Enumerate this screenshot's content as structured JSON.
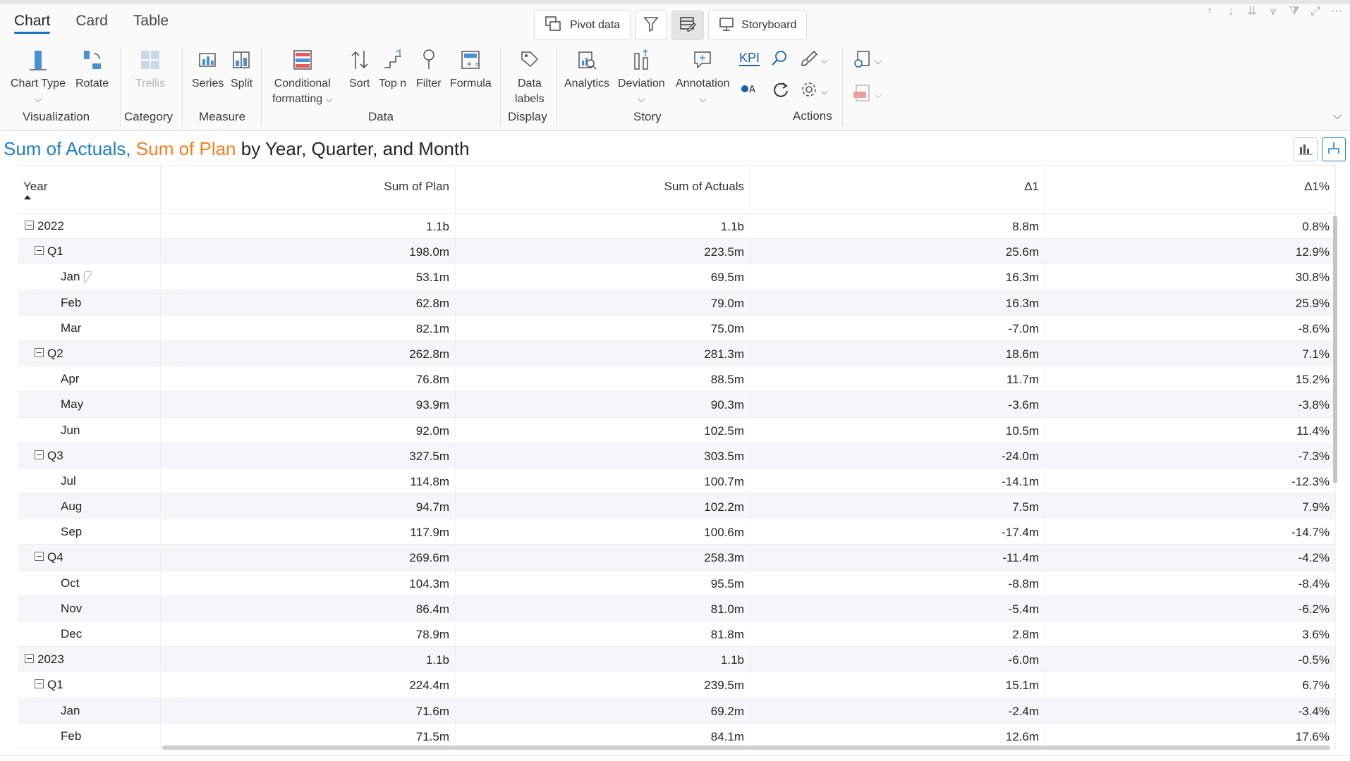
{
  "ribbon": {
    "tabs": [
      {
        "label": "Chart",
        "active": true
      },
      {
        "label": "Card",
        "active": false
      },
      {
        "label": "Table",
        "active": false
      }
    ],
    "pivot_label": "Pivot data",
    "storyboard_label": "Storyboard",
    "items": {
      "chart_type": "Chart Type",
      "rotate": "Rotate",
      "trellis": "Trellis",
      "series": "Series",
      "split": "Split",
      "conditional": "Conditional",
      "formatting": "formatting",
      "sort": "Sort",
      "topn": "Top n",
      "filter": "Filter",
      "formula": "Formula",
      "data": "Data",
      "labels": "labels",
      "analytics": "Analytics",
      "deviation": "Deviation",
      "annotation": "Annotation",
      "kpi": "KPI"
    },
    "groups": {
      "visualization": "Visualization",
      "category": "Category",
      "measure": "Measure",
      "data": "Data",
      "display": "Display",
      "story": "Story",
      "actions": "Actions"
    }
  },
  "title": {
    "actuals": "Sum of Actuals",
    "comma": ",",
    "plan": "Sum of Plan",
    "rest": "by Year, Quarter, and Month"
  },
  "table": {
    "headers": [
      "Year",
      "Sum of Plan",
      "Sum of Actuals",
      "Δ1",
      "Δ1%"
    ],
    "rows": [
      {
        "label": "2022",
        "level": 0,
        "plan": "1.1b",
        "actuals": "1.1b",
        "d1": "8.8m",
        "d1p": "0.8%"
      },
      {
        "label": "Q1",
        "level": 1,
        "plan": "198.0m",
        "actuals": "223.5m",
        "d1": "25.6m",
        "d1p": "12.9%"
      },
      {
        "label": "Jan",
        "level": 2,
        "plan": "53.1m",
        "actuals": "69.5m",
        "d1": "16.3m",
        "d1p": "30.8%"
      },
      {
        "label": "Feb",
        "level": 2,
        "plan": "62.8m",
        "actuals": "79.0m",
        "d1": "16.3m",
        "d1p": "25.9%"
      },
      {
        "label": "Mar",
        "level": 2,
        "plan": "82.1m",
        "actuals": "75.0m",
        "d1": "-7.0m",
        "d1p": "-8.6%"
      },
      {
        "label": "Q2",
        "level": 1,
        "plan": "262.8m",
        "actuals": "281.3m",
        "d1": "18.6m",
        "d1p": "7.1%"
      },
      {
        "label": "Apr",
        "level": 2,
        "plan": "76.8m",
        "actuals": "88.5m",
        "d1": "11.7m",
        "d1p": "15.2%"
      },
      {
        "label": "May",
        "level": 2,
        "plan": "93.9m",
        "actuals": "90.3m",
        "d1": "-3.6m",
        "d1p": "-3.8%"
      },
      {
        "label": "Jun",
        "level": 2,
        "plan": "92.0m",
        "actuals": "102.5m",
        "d1": "10.5m",
        "d1p": "11.4%"
      },
      {
        "label": "Q3",
        "level": 1,
        "plan": "327.5m",
        "actuals": "303.5m",
        "d1": "-24.0m",
        "d1p": "-7.3%"
      },
      {
        "label": "Jul",
        "level": 2,
        "plan": "114.8m",
        "actuals": "100.7m",
        "d1": "-14.1m",
        "d1p": "-12.3%"
      },
      {
        "label": "Aug",
        "level": 2,
        "plan": "94.7m",
        "actuals": "102.2m",
        "d1": "7.5m",
        "d1p": "7.9%"
      },
      {
        "label": "Sep",
        "level": 2,
        "plan": "117.9m",
        "actuals": "100.6m",
        "d1": "-17.4m",
        "d1p": "-14.7%"
      },
      {
        "label": "Q4",
        "level": 1,
        "plan": "269.6m",
        "actuals": "258.3m",
        "d1": "-11.4m",
        "d1p": "-4.2%"
      },
      {
        "label": "Oct",
        "level": 2,
        "plan": "104.3m",
        "actuals": "95.5m",
        "d1": "-8.8m",
        "d1p": "-8.4%"
      },
      {
        "label": "Nov",
        "level": 2,
        "plan": "86.4m",
        "actuals": "81.0m",
        "d1": "-5.4m",
        "d1p": "-6.2%"
      },
      {
        "label": "Dec",
        "level": 2,
        "plan": "78.9m",
        "actuals": "81.8m",
        "d1": "2.8m",
        "d1p": "3.6%"
      },
      {
        "label": "2023",
        "level": 0,
        "plan": "1.1b",
        "actuals": "1.1b",
        "d1": "-6.0m",
        "d1p": "-0.5%"
      },
      {
        "label": "Q1",
        "level": 1,
        "plan": "224.4m",
        "actuals": "239.5m",
        "d1": "15.1m",
        "d1p": "6.7%"
      },
      {
        "label": "Jan",
        "level": 2,
        "plan": "71.6m",
        "actuals": "69.2m",
        "d1": "-2.4m",
        "d1p": "-3.4%"
      },
      {
        "label": "Feb",
        "level": 2,
        "plan": "71.5m",
        "actuals": "84.1m",
        "d1": "12.6m",
        "d1p": "17.6%"
      }
    ]
  },
  "colors": {
    "actuals": "#1f7dc8",
    "plan": "#f07f1f",
    "accent": "#1a73c7"
  }
}
